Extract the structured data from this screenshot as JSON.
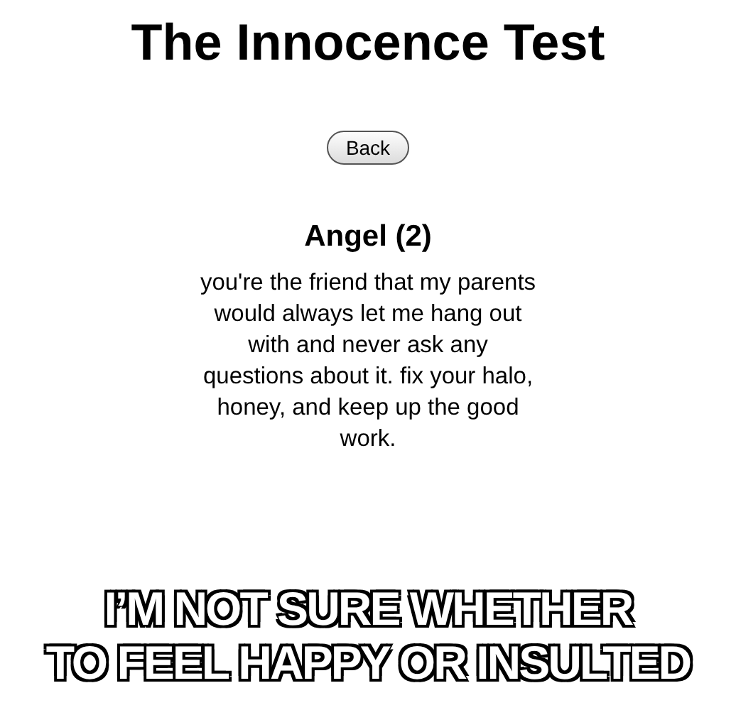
{
  "page": {
    "title": "The Innocence Test",
    "back_button": "Back"
  },
  "result": {
    "heading": "Angel (2)",
    "text": "you're the friend that my parents would always let me hang out with and never ask any questions about it. fix your halo, honey, and keep up the good work."
  },
  "caption": {
    "lines": [
      "I’M NOT SURE WHETHER",
      "TO FEEL HAPPY OR INSULTED"
    ]
  }
}
